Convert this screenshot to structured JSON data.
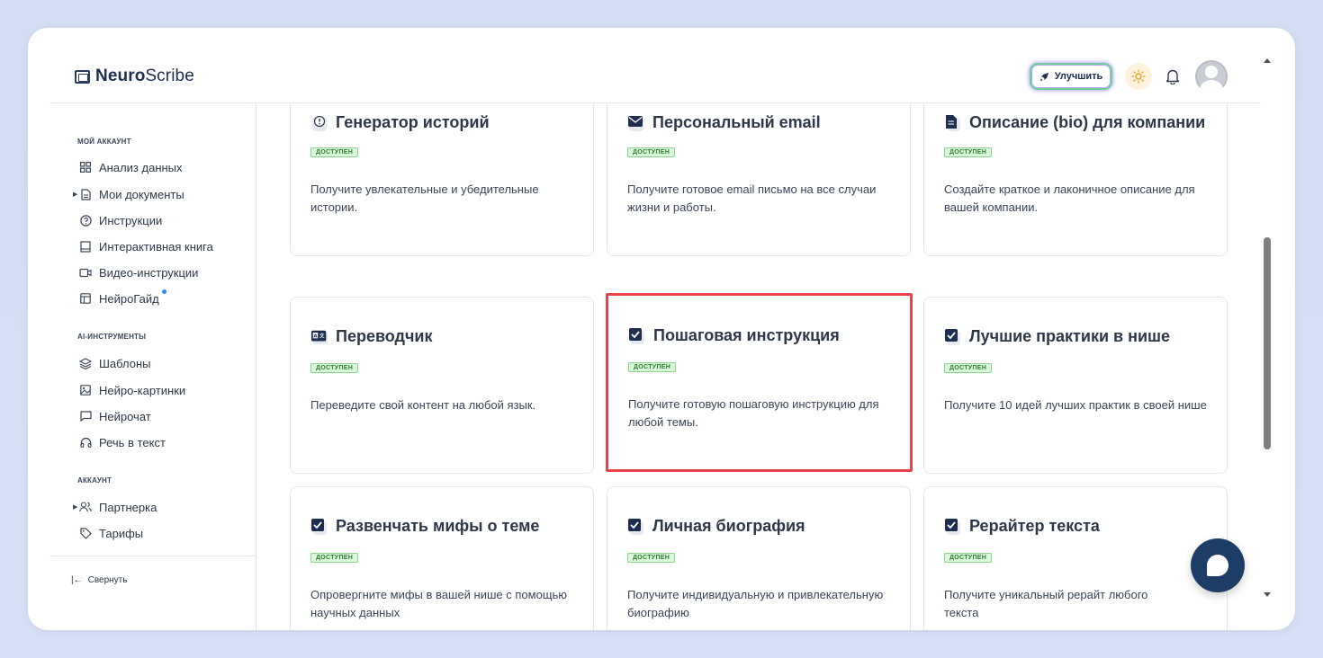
{
  "app": {
    "logo_bold": "Neuro",
    "logo_regular": "Scribe"
  },
  "header": {
    "upgrade_label": "Улучшить",
    "icons": [
      "rocket-icon",
      "sun-icon",
      "bell-icon",
      "avatar"
    ]
  },
  "sidebar": {
    "sections": [
      {
        "label": "МОЙ АККАУНТ",
        "items": [
          {
            "label": "Анализ данных",
            "icon": "grid-icon"
          },
          {
            "label": "Мои документы",
            "icon": "document-icon",
            "expandable": true
          },
          {
            "label": "Инструкции",
            "icon": "help-circle-icon"
          },
          {
            "label": "Интерактивная книга",
            "icon": "book-icon"
          },
          {
            "label": "Видео-инструкции",
            "icon": "video-icon"
          },
          {
            "label": "НейроГайд",
            "icon": "layout-icon",
            "dot": true
          }
        ]
      },
      {
        "label": "AI-ИНСТРУМЕНТЫ",
        "items": [
          {
            "label": "Шаблоны",
            "icon": "layers-icon",
            "active": true
          },
          {
            "label": "Нейро-картинки",
            "icon": "image-icon"
          },
          {
            "label": "Нейрочат",
            "icon": "chat-icon"
          },
          {
            "label": "Речь в текст",
            "icon": "headphones-icon"
          }
        ]
      },
      {
        "label": "АККАУНТ",
        "items": [
          {
            "label": "Партнерка",
            "icon": "users-icon",
            "expandable": true
          },
          {
            "label": "Тарифы",
            "icon": "tag-icon"
          }
        ]
      }
    ],
    "collapse_label": "Свернуть"
  },
  "cards": [
    {
      "title": "Генератор историй",
      "badge": "ДОСТУПЕН",
      "desc": "Получите увлекательные и убедительные истории.",
      "icon": "idea-icon"
    },
    {
      "title": "Персональный email",
      "badge": "ДОСТУПЕН",
      "desc": "Получите готовое email письмо на все случаи жизни и работы.",
      "icon": "mail-icon"
    },
    {
      "title": "Описание (bio) для компании",
      "badge": "ДОСТУПЕН",
      "desc": "Создайте краткое и лаконичное описание для вашей компании.",
      "icon": "file-icon"
    },
    {
      "title": "Переводчик",
      "badge": "ДОСТУПЕН",
      "desc": "Переведите свой контент на любой язык.",
      "icon": "translate-icon"
    },
    {
      "title": "Пошаговая инструкция",
      "badge": "ДОСТУПЕН",
      "desc": "Получите готовую пошаговую инструкцию для любой темы.",
      "icon": "check-box-icon",
      "highlighted": true
    },
    {
      "title": "Лучшие практики в нише",
      "badge": "ДОСТУПЕН",
      "desc": "Получите 10 идей лучших практик в своей нише",
      "icon": "check-box-icon"
    },
    {
      "title": "Развенчать мифы о теме",
      "badge": "ДОСТУПЕН",
      "desc": "Опровергните мифы в вашей нише с помощью научных данных",
      "icon": "check-box-icon"
    },
    {
      "title": "Личная биография",
      "badge": "ДОСТУПЕН",
      "desc": "Получите индивидуальную и привлекательную биографию",
      "icon": "check-box-icon"
    },
    {
      "title": "Рерайтер текста",
      "badge": "ДОСТУПЕН",
      "desc": "Получите уникальный рерайт любого текста",
      "icon": "check-box-icon"
    }
  ],
  "colors": {
    "highlight_border": "#e8434a",
    "badge_bg": "#d9f7d9",
    "badge_text": "#2e7d32",
    "chat_button": "#1c3d66",
    "brand_text": "#1d2e4f"
  }
}
